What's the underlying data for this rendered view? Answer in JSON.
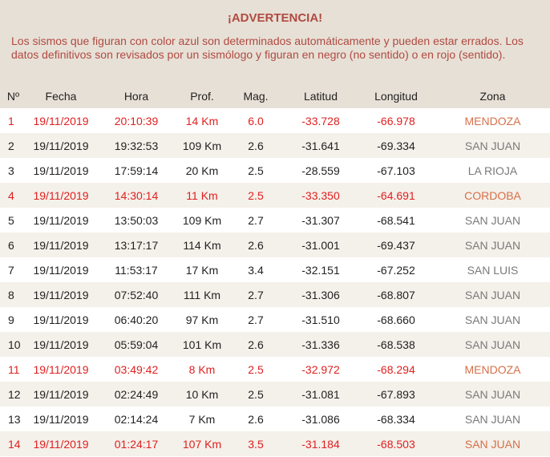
{
  "warning": {
    "title": "¡ADVERTENCIA!",
    "text": "Los sismos que figuran con color azul son determinados automáticamente y pueden estar errados. Los datos definitivos son revisados por un sismólogo y figuran en negro (no sentido) o en rojo (sentido)."
  },
  "table": {
    "headers": [
      "Nº",
      "Fecha",
      "Hora",
      "Prof.",
      "Mag.",
      "Latitud",
      "Longitud",
      "Zona"
    ],
    "rows": [
      {
        "n": "1",
        "fecha": "19/11/2019",
        "hora": "20:10:39",
        "prof": "14 Km",
        "mag": "6.0",
        "lat": "-33.728",
        "lon": "-66.978",
        "zona": "MENDOZA",
        "sentido": true
      },
      {
        "n": "2",
        "fecha": "19/11/2019",
        "hora": "19:32:53",
        "prof": "109 Km",
        "mag": "2.6",
        "lat": "-31.641",
        "lon": "-69.334",
        "zona": "SAN JUAN",
        "sentido": false
      },
      {
        "n": "3",
        "fecha": "19/11/2019",
        "hora": "17:59:14",
        "prof": "20 Km",
        "mag": "2.5",
        "lat": "-28.559",
        "lon": "-67.103",
        "zona": "LA RIOJA",
        "sentido": false
      },
      {
        "n": "4",
        "fecha": "19/11/2019",
        "hora": "14:30:14",
        "prof": "11 Km",
        "mag": "2.5",
        "lat": "-33.350",
        "lon": "-64.691",
        "zona": "CORDOBA",
        "sentido": true
      },
      {
        "n": "5",
        "fecha": "19/11/2019",
        "hora": "13:50:03",
        "prof": "109 Km",
        "mag": "2.7",
        "lat": "-31.307",
        "lon": "-68.541",
        "zona": "SAN JUAN",
        "sentido": false
      },
      {
        "n": "6",
        "fecha": "19/11/2019",
        "hora": "13:17:17",
        "prof": "114 Km",
        "mag": "2.6",
        "lat": "-31.001",
        "lon": "-69.437",
        "zona": "SAN JUAN",
        "sentido": false
      },
      {
        "n": "7",
        "fecha": "19/11/2019",
        "hora": "11:53:17",
        "prof": "17 Km",
        "mag": "3.4",
        "lat": "-32.151",
        "lon": "-67.252",
        "zona": "SAN LUIS",
        "sentido": false
      },
      {
        "n": "8",
        "fecha": "19/11/2019",
        "hora": "07:52:40",
        "prof": "111 Km",
        "mag": "2.7",
        "lat": "-31.306",
        "lon": "-68.807",
        "zona": "SAN JUAN",
        "sentido": false
      },
      {
        "n": "9",
        "fecha": "19/11/2019",
        "hora": "06:40:20",
        "prof": "97 Km",
        "mag": "2.7",
        "lat": "-31.510",
        "lon": "-68.660",
        "zona": "SAN JUAN",
        "sentido": false
      },
      {
        "n": "10",
        "fecha": "19/11/2019",
        "hora": "05:59:04",
        "prof": "101 Km",
        "mag": "2.6",
        "lat": "-31.336",
        "lon": "-68.538",
        "zona": "SAN JUAN",
        "sentido": false
      },
      {
        "n": "11",
        "fecha": "19/11/2019",
        "hora": "03:49:42",
        "prof": "8 Km",
        "mag": "2.5",
        "lat": "-32.972",
        "lon": "-68.294",
        "zona": "MENDOZA",
        "sentido": true
      },
      {
        "n": "12",
        "fecha": "19/11/2019",
        "hora": "02:24:49",
        "prof": "10 Km",
        "mag": "2.5",
        "lat": "-31.081",
        "lon": "-67.893",
        "zona": "SAN JUAN",
        "sentido": false
      },
      {
        "n": "13",
        "fecha": "19/11/2019",
        "hora": "02:14:24",
        "prof": "7 Km",
        "mag": "2.6",
        "lat": "-31.086",
        "lon": "-68.334",
        "zona": "SAN JUAN",
        "sentido": false
      },
      {
        "n": "14",
        "fecha": "19/11/2019",
        "hora": "01:24:17",
        "prof": "107 Km",
        "mag": "3.5",
        "lat": "-31.184",
        "lon": "-68.503",
        "zona": "SAN JUAN",
        "sentido": true
      }
    ]
  },
  "colors": {
    "warning_bg": "#e7e0d6",
    "warning_text": "#b04a41",
    "sentido_red": "#e01f1f",
    "zona_sentido": "#d6704a",
    "zona_normal": "#7a7a7a",
    "row_alt": "#f4f0ea"
  }
}
